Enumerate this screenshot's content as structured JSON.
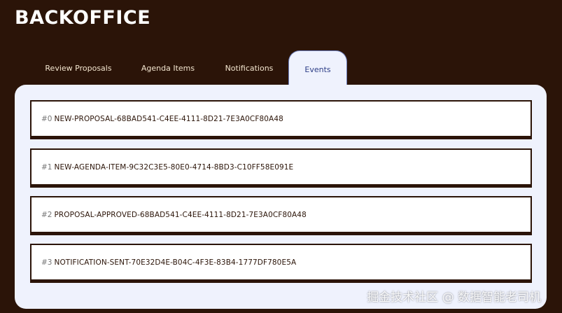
{
  "app": {
    "title": "BACKOFFICE"
  },
  "tabs": [
    {
      "label": "Review Proposals",
      "active": false
    },
    {
      "label": "Agenda Items",
      "active": false
    },
    {
      "label": "Notifications",
      "active": false
    },
    {
      "label": "Events",
      "active": true
    }
  ],
  "events": [
    {
      "index": "#0",
      "name": "NEW-PROPOSAL-68BAD541-C4EE-4111-8D21-7E3A0CF80A48"
    },
    {
      "index": "#1",
      "name": "NEW-AGENDA-ITEM-9C32C3E5-80E0-4714-8BD3-C10FF58E091E"
    },
    {
      "index": "#2",
      "name": "PROPOSAL-APPROVED-68BAD541-C4EE-4111-8D21-7E3A0CF80A48"
    },
    {
      "index": "#3",
      "name": "NOTIFICATION-SENT-70E32D4E-B04C-4F3E-83B4-1777DF780E5A"
    }
  ],
  "watermark": "掘金技术社区 @ 数据智能老司机",
  "colors": {
    "background": "#2b1408",
    "panel": "#eff2fd",
    "active_tab_text": "#2c3d86",
    "tab_text": "#f3e6cf"
  }
}
